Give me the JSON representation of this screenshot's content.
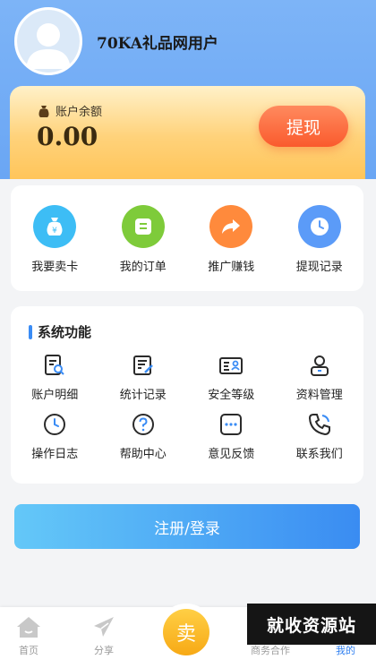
{
  "profile": {
    "username": "70KA礼品网用户",
    "avatar_icon": "user-avatar-icon"
  },
  "balance": {
    "label": "账户余额",
    "value": "0.00",
    "withdraw_label": "提现"
  },
  "quick_actions": [
    {
      "label": "我要卖卡",
      "icon": "money-bag-icon",
      "color": "#3dbdf5"
    },
    {
      "label": "我的订单",
      "icon": "order-list-icon",
      "color": "#7ecb3a"
    },
    {
      "label": "推广赚钱",
      "icon": "share-arrow-icon",
      "color": "#ff8a3c"
    },
    {
      "label": "提现记录",
      "icon": "clock-icon",
      "color": "#5b9bf8"
    }
  ],
  "system": {
    "title": "系统功能",
    "items": [
      {
        "label": "账户明细",
        "icon": "account-detail-icon"
      },
      {
        "label": "统计记录",
        "icon": "statistics-icon"
      },
      {
        "label": "安全等级",
        "icon": "id-card-icon"
      },
      {
        "label": "资料管理",
        "icon": "user-profile-icon"
      },
      {
        "label": "操作日志",
        "icon": "clock-log-icon"
      },
      {
        "label": "帮助中心",
        "icon": "help-icon"
      },
      {
        "label": "意见反馈",
        "icon": "feedback-icon"
      },
      {
        "label": "联系我们",
        "icon": "phone-icon"
      }
    ]
  },
  "login_label": "注册/登录",
  "tabbar": {
    "home": "首页",
    "share": "分享",
    "sell": "卖",
    "business": "商务合作",
    "mine": "我的"
  },
  "watermark": "就收资源站",
  "colors": {
    "accent": "#2f7ff0",
    "header": "#6aa6f4",
    "withdraw": "#fa5a2d",
    "sell": "#f7a915"
  }
}
